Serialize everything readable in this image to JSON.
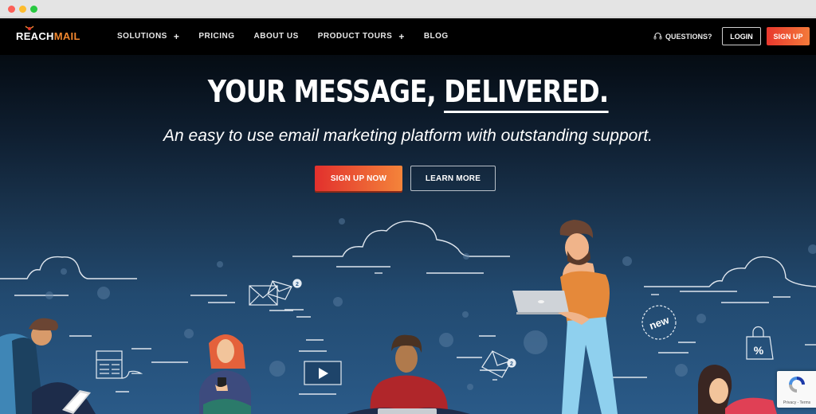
{
  "brand": {
    "logo_part1": "REACH",
    "logo_part2": "MAIL",
    "accent": "#f0862e",
    "cta_gradient": [
      "#e2302d",
      "#f4843a"
    ]
  },
  "nav": {
    "items": [
      {
        "label": "SOLUTIONS",
        "has_submenu": true,
        "submenu_icon": "+"
      },
      {
        "label": "PRICING",
        "has_submenu": false
      },
      {
        "label": "ABOUT US",
        "has_submenu": false
      },
      {
        "label": "PRODUCT TOURS",
        "has_submenu": true,
        "submenu_icon": "+"
      },
      {
        "label": "BLOG",
        "has_submenu": false
      }
    ],
    "questions_label": "QUESTIONS?",
    "questions_icon": "headset-icon",
    "login_label": "LOGIN",
    "signup_label": "SIGN UP"
  },
  "hero": {
    "headline_part1": "YOUR MESSAGE, ",
    "headline_part2": "DELIVERED.",
    "subheadline": "An easy to use email marketing platform with outstanding support.",
    "primary_cta": "SIGN UP NOW",
    "secondary_cta": "LEARN MORE"
  },
  "illustration": {
    "badges": {
      "new_badge": "new",
      "envelope_count": "2",
      "sale_tag": "%"
    }
  },
  "recaptcha": {
    "label": "Privacy - Terms"
  }
}
